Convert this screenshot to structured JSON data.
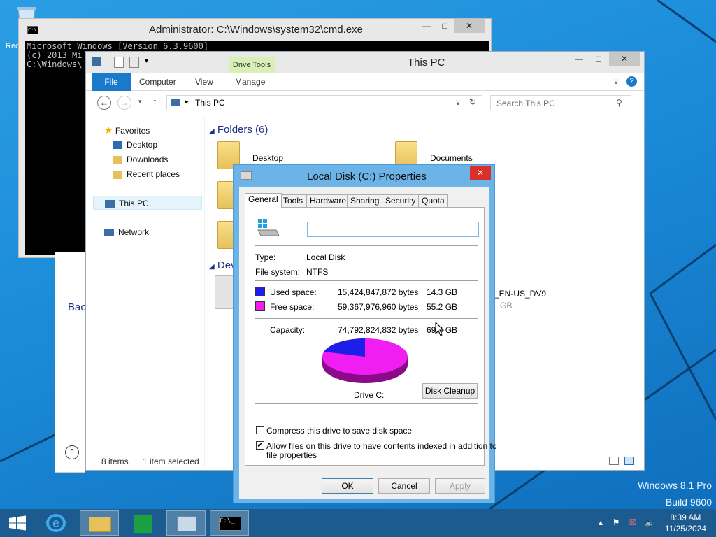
{
  "desktop": {
    "recycle_label": "Rec",
    "watermark_line1": "Windows 8.1 Pro",
    "watermark_line2": "Build 9600"
  },
  "cmd": {
    "title": "Administrator: C:\\Windows\\system32\\cmd.exe",
    "lines": [
      "Microsoft Windows [Version 6.3.9600]",
      "(c) 2013 Mi",
      "",
      "C:\\Windows\\"
    ]
  },
  "explorer": {
    "title": "This PC",
    "drive_tools": "Drive Tools",
    "tabs": {
      "file": "File",
      "computer": "Computer",
      "view": "View",
      "manage": "Manage"
    },
    "address": "This PC",
    "search_placeholder": "Search This PC",
    "nav": {
      "favorites": "Favorites",
      "desktop": "Desktop",
      "downloads": "Downloads",
      "recent": "Recent places",
      "this_pc": "This PC",
      "network": "Network"
    },
    "folders_header": "Folders (6)",
    "devices_header": "Dev",
    "folders": {
      "desktop": "Desktop",
      "documents": "Documents"
    },
    "drive_label_fragment": "_EN-US_DV9",
    "drive_size_fragment": "GB",
    "status": {
      "items": "8 items",
      "selected": "1 item selected"
    },
    "behind_label": "Bac"
  },
  "props": {
    "title": "Local Disk (C:) Properties",
    "tabs": [
      "General",
      "Tools",
      "Hardware",
      "Sharing",
      "Security",
      "Quota"
    ],
    "name_value": "",
    "type_label": "Type:",
    "type_value": "Local Disk",
    "fs_label": "File system:",
    "fs_value": "NTFS",
    "used_label": "Used space:",
    "used_bytes": "15,424,847,872 bytes",
    "used_gb": "14.3 GB",
    "free_label": "Free space:",
    "free_bytes": "59,367,976,960 bytes",
    "free_gb": "55.2 GB",
    "cap_label": "Capacity:",
    "cap_bytes": "74,792,824,832 bytes",
    "cap_gb": "69.6 GB",
    "drive_label": "Drive C:",
    "disk_cleanup": "Disk Cleanup",
    "compress_label": "Compress this drive to save disk space",
    "compress_checked": false,
    "index_label_1": "Allow files on this drive to have contents indexed in addition to",
    "index_label_2": "file properties",
    "index_checked": true,
    "ok": "OK",
    "cancel": "Cancel",
    "apply": "Apply",
    "used_color": "#1e1ee6",
    "free_color": "#f01ef0"
  },
  "taskbar": {
    "time": "8:39 AM",
    "date": "11/25/2024"
  }
}
